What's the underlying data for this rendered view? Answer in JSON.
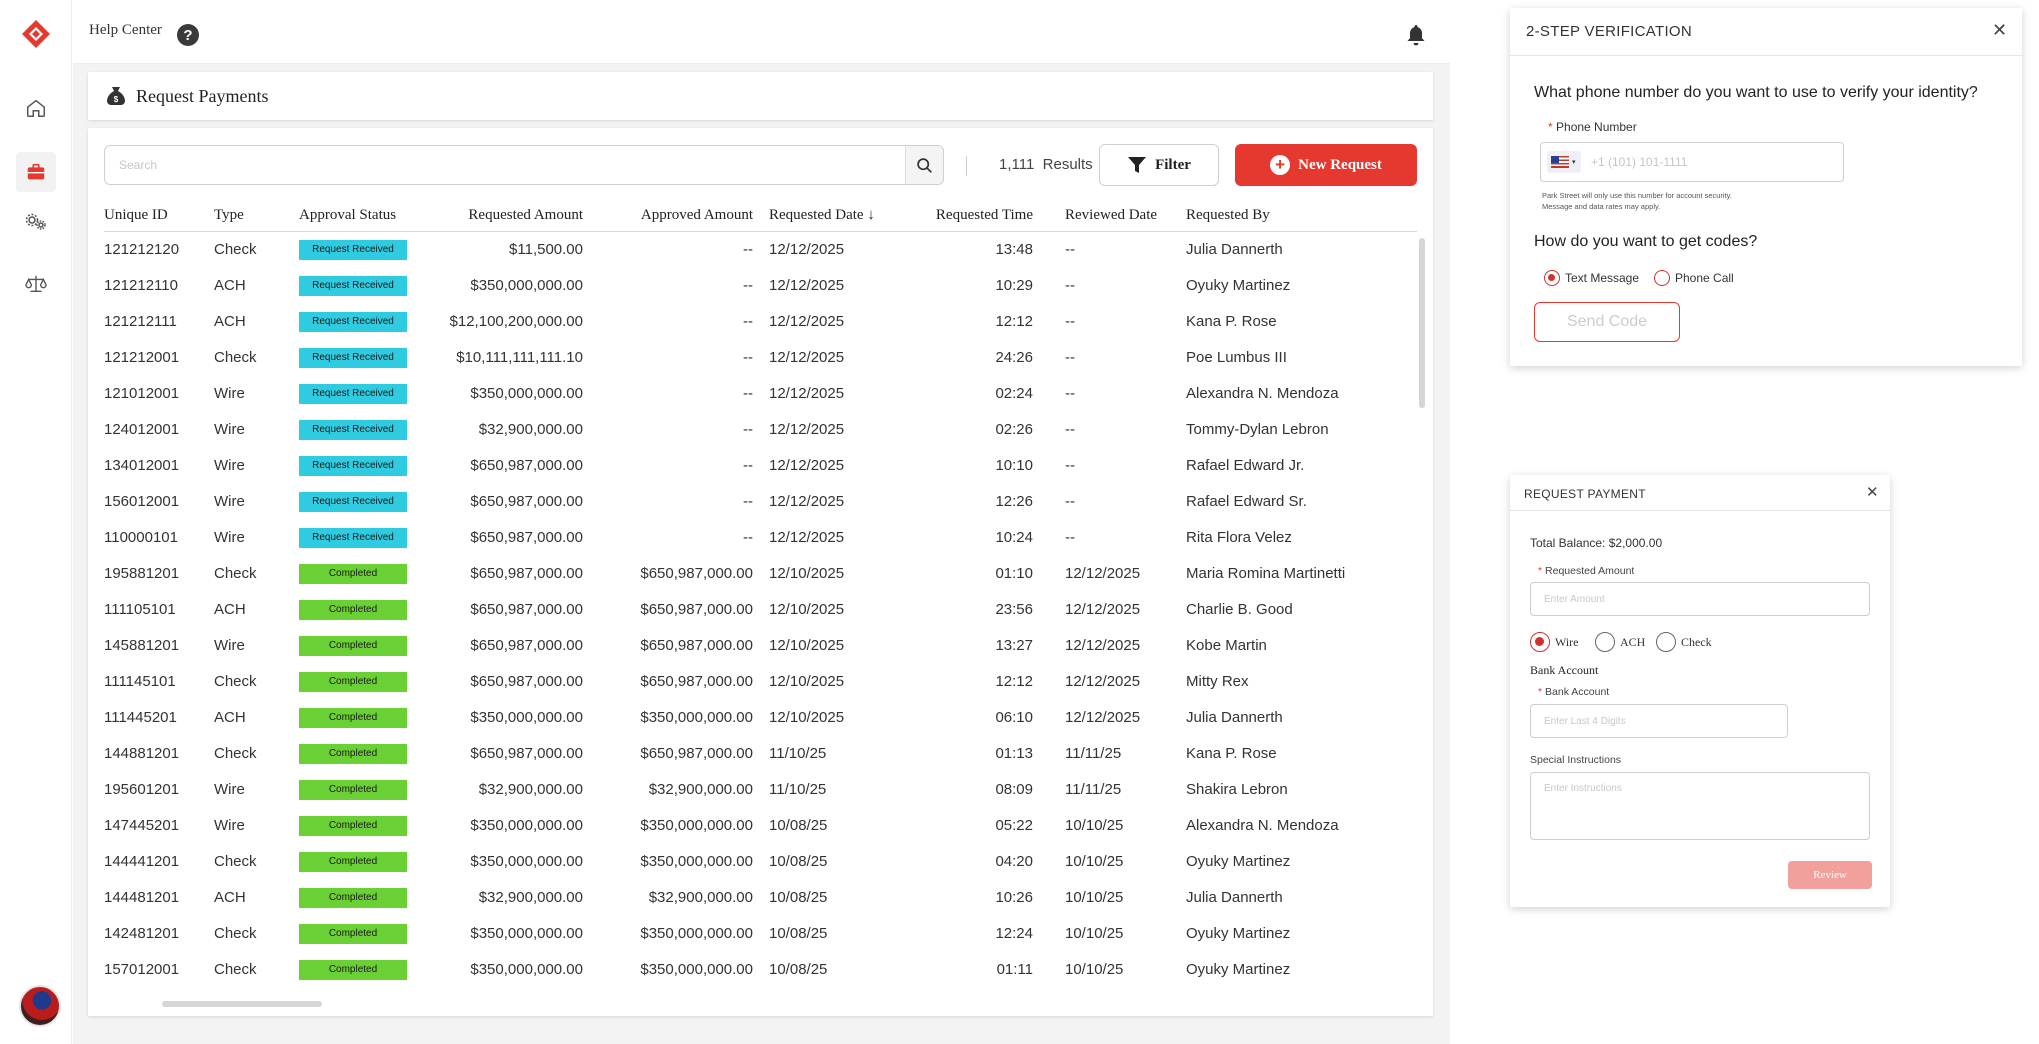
{
  "topbar": {
    "help_label": "Help Center",
    "help_icon": "?"
  },
  "page": {
    "title": "Request Payments"
  },
  "toolbar": {
    "search_placeholder": "Search",
    "results_count": "1,111",
    "results_label": "Results",
    "filter_label": "Filter",
    "new_request_label": "New Request",
    "accent_color": "#e5392f"
  },
  "table": {
    "columns": [
      "Unique ID",
      "Type",
      "Approval Status",
      "Requested Amount",
      "Approved Amount",
      "Requested Date ↓",
      "Requested Time",
      "Reviewed Date",
      "Requested By"
    ],
    "rows": [
      [
        "121212120",
        "Check",
        "Request Received",
        "$11,500.00",
        "--",
        "12/12/2025",
        "13:48",
        "--",
        "Julia Dannerth"
      ],
      [
        "121212110",
        "ACH",
        "Request Received",
        "$350,000,000.00",
        "--",
        "12/12/2025",
        "10:29",
        "--",
        "Oyuky Martinez"
      ],
      [
        "121212111",
        "ACH",
        "Request Received",
        "$12,100,200,000.00",
        "--",
        "12/12/2025",
        "12:12",
        "--",
        "Kana P. Rose"
      ],
      [
        "121212001",
        "Check",
        "Request Received",
        "$10,111,111,111.10",
        "--",
        "12/12/2025",
        "24:26",
        "--",
        "Poe Lumbus III"
      ],
      [
        "121012001",
        "Wire",
        "Request Received",
        "$350,000,000.00",
        "--",
        "12/12/2025",
        "02:24",
        "--",
        "Alexandra N. Mendoza"
      ],
      [
        "124012001",
        "Wire",
        "Request Received",
        "$32,900,000.00",
        "--",
        "12/12/2025",
        "02:26",
        "--",
        "Tommy-Dylan Lebron"
      ],
      [
        "134012001",
        "Wire",
        "Request Received",
        "$650,987,000.00",
        "--",
        "12/12/2025",
        "10:10",
        "--",
        "Rafael Edward Jr."
      ],
      [
        "156012001",
        "Wire",
        "Request Received",
        "$650,987,000.00",
        "--",
        "12/12/2025",
        "12:26",
        "--",
        "Rafael Edward Sr."
      ],
      [
        "110000101",
        "Wire",
        "Request Received",
        "$650,987,000.00",
        "--",
        "12/12/2025",
        "10:24",
        "--",
        "Rita Flora Velez"
      ],
      [
        "195881201",
        "Check",
        "Completed",
        "$650,987,000.00",
        "$650,987,000.00",
        "12/10/2025",
        "01:10",
        "12/12/2025",
        "Maria Romina Martinetti"
      ],
      [
        "111105101",
        "ACH",
        "Completed",
        "$650,987,000.00",
        "$650,987,000.00",
        "12/10/2025",
        "23:56",
        "12/12/2025",
        "Charlie B. Good"
      ],
      [
        "145881201",
        "Wire",
        "Completed",
        "$650,987,000.00",
        "$650,987,000.00",
        "12/10/2025",
        "13:27",
        "12/12/2025",
        "Kobe Martin"
      ],
      [
        "111145101",
        "Check",
        "Completed",
        "$650,987,000.00",
        "$650,987,000.00",
        "12/10/2025",
        "12:12",
        "12/12/2025",
        "Mitty Rex"
      ],
      [
        "111445201",
        "ACH",
        "Completed",
        "$350,000,000.00",
        "$350,000,000.00",
        "12/10/2025",
        "06:10",
        "12/12/2025",
        "Julia Dannerth"
      ],
      [
        "144881201",
        "Check",
        "Completed",
        "$650,987,000.00",
        "$650,987,000.00",
        "11/10/25",
        "01:13",
        "11/11/25",
        "Kana P. Rose"
      ],
      [
        "195601201",
        "Wire",
        "Completed",
        "$32,900,000.00",
        "$32,900,000.00",
        "11/10/25",
        "08:09",
        "11/11/25",
        "Shakira Lebron"
      ],
      [
        "147445201",
        "Wire",
        "Completed",
        "$350,000,000.00",
        "$350,000,000.00",
        "10/08/25",
        "05:22",
        "10/10/25",
        "Alexandra N. Mendoza"
      ],
      [
        "144441201",
        "Check",
        "Completed",
        "$350,000,000.00",
        "$350,000,000.00",
        "10/08/25",
        "04:20",
        "10/10/25",
        "Oyuky Martinez"
      ],
      [
        "144481201",
        "ACH",
        "Completed",
        "$32,900,000.00",
        "$32,900,000.00",
        "10/08/25",
        "10:26",
        "10/10/25",
        "Julia Dannerth"
      ],
      [
        "142481201",
        "Check",
        "Completed",
        "$350,000,000.00",
        "$350,000,000.00",
        "10/08/25",
        "12:24",
        "10/10/25",
        "Oyuky Martinez"
      ],
      [
        "157012001",
        "Check",
        "Completed",
        "$350,000,000.00",
        "$350,000,000.00",
        "10/08/25",
        "01:11",
        "10/10/25",
        "Oyuky Martinez"
      ]
    ],
    "status_colors": {
      "Request Received": "#2fcbe0",
      "Completed": "#6ad134"
    }
  },
  "verify_modal": {
    "title": "2-STEP VERIFICATION",
    "close": "✕",
    "question_phone": "What phone number do you want to use to verify your identity?",
    "phone_label": "Phone Number",
    "phone_placeholder": "+1 (101) 101-1111",
    "note_line1": "Park Street will only use this number for account security.",
    "note_line2": "Message and data rates may apply.",
    "question_codes": "How do you want to get codes?",
    "option_text": "Text Message",
    "option_call": "Phone Call",
    "send_label": "Send Code"
  },
  "payment_modal": {
    "title": "REQUEST PAYMENT",
    "close": "✕",
    "balance_label": "Total Balance:",
    "balance_value": "$2,000.00",
    "amount_label": "Requested Amount",
    "amount_placeholder": "Enter Amount",
    "methods": [
      "Wire",
      "ACH",
      "Check"
    ],
    "bank_title": "Bank Account",
    "bank_label": "Bank Account",
    "bank_placeholder": "Enter Last 4 Digits",
    "instructions_label": "Special Instructions",
    "instructions_placeholder": "Enter Instructions",
    "review_label": "Review"
  }
}
